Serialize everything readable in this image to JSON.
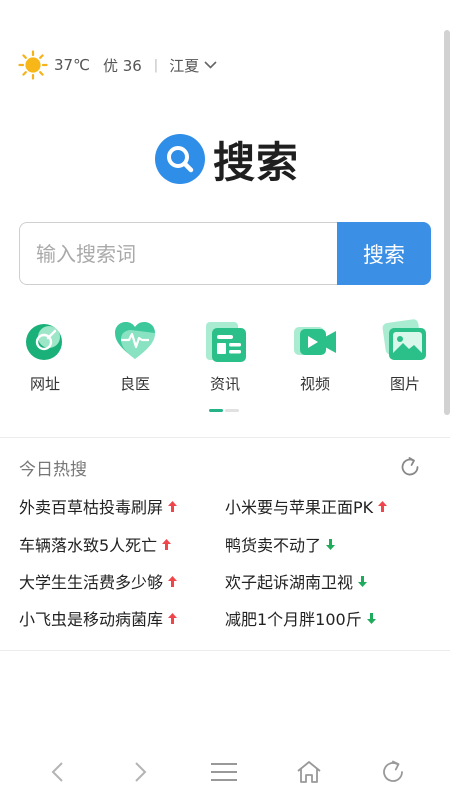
{
  "weather": {
    "icon": "sun-icon",
    "temperature": "37℃",
    "aqi": "优 36",
    "separator": "|",
    "city": "江夏"
  },
  "logo": {
    "icon": "search-logo-icon",
    "text": "搜索"
  },
  "search": {
    "placeholder": "输入搜索词",
    "button_label": "搜索",
    "accent_color": "#3b8fe4"
  },
  "categories": [
    {
      "label": "网址",
      "icon": "website-icon"
    },
    {
      "label": "良医",
      "icon": "heart-pulse-icon"
    },
    {
      "label": "资讯",
      "icon": "news-icon"
    },
    {
      "label": "视频",
      "icon": "video-icon"
    },
    {
      "label": "图片",
      "icon": "image-icon"
    }
  ],
  "hot": {
    "title": "今日热搜",
    "refresh_icon": "refresh-icon",
    "items": [
      {
        "text": "外卖百草枯投毒刷屏",
        "trend": "up"
      },
      {
        "text": "小米要与苹果正面PK",
        "trend": "up"
      },
      {
        "text": "车辆落水致5人死亡",
        "trend": "up"
      },
      {
        "text": "鸭货卖不动了",
        "trend": "down"
      },
      {
        "text": "大学生生活费多少够",
        "trend": "up"
      },
      {
        "text": "欢子起诉湖南卫视",
        "trend": "down"
      },
      {
        "text": "小飞虫是移动病菌库",
        "trend": "up"
      },
      {
        "text": "减肥1个月胖100斤",
        "trend": "down"
      }
    ],
    "up_color": "#f0454b",
    "down_color": "#1fab5c"
  },
  "bottom_nav": [
    {
      "icon": "back-arrow-icon"
    },
    {
      "icon": "forward-arrow-icon"
    },
    {
      "icon": "menu-icon"
    },
    {
      "icon": "home-icon"
    },
    {
      "icon": "refresh-icon"
    }
  ]
}
